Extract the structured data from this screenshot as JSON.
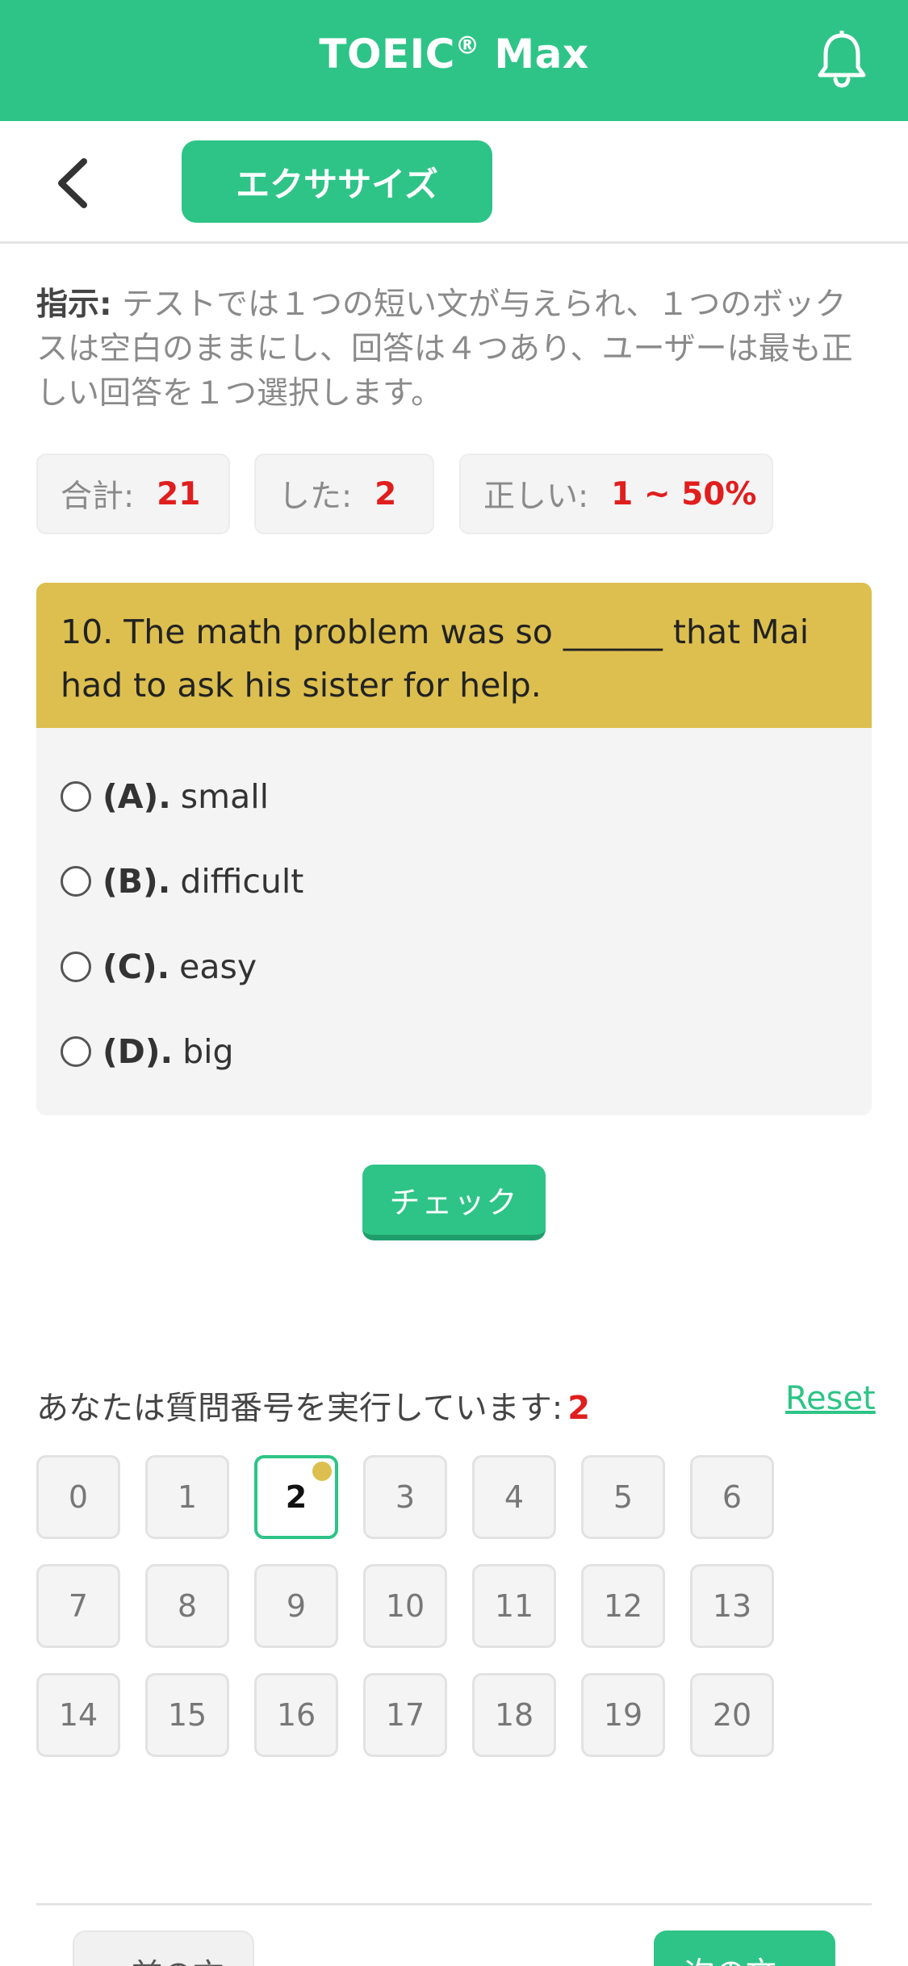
{
  "header": {
    "title": "TOEIC",
    "title_mark": "®",
    "title_suffix": " Max",
    "bell_icon": "bell-icon"
  },
  "subbar": {
    "back_icon": "chevron-left-icon",
    "tab_label": "エクササイズ"
  },
  "instructions": {
    "label": "指示:",
    "text": " テストでは１つの短い文が与えられ、１つのボックスは空白のままにし、回答は４つあり、ユーザーは最も正しい回答を１つ選択します。"
  },
  "stats": {
    "total_label": "合計:",
    "total_value": "21",
    "done_label": "した:",
    "done_value": "2",
    "correct_label": "正しい:",
    "correct_value": "1 ~ 50%"
  },
  "question": {
    "text": "10. The math problem was so ______ that Mai had to ask his sister for help.",
    "options": [
      {
        "letter": "(A).",
        "text": "small"
      },
      {
        "letter": "(B).",
        "text": "difficult"
      },
      {
        "letter": "(C).",
        "text": "easy"
      },
      {
        "letter": "(D).",
        "text": "big"
      }
    ]
  },
  "check_label": "チェック",
  "progress": {
    "label": "あなたは質問番号を実行しています:",
    "current": "2",
    "reset_label": "Reset",
    "numbers": [
      "0",
      "1",
      "2",
      "3",
      "4",
      "5",
      "6",
      "7",
      "8",
      "9",
      "10",
      "11",
      "12",
      "13",
      "14",
      "15",
      "16",
      "17",
      "18",
      "19",
      "20"
    ]
  },
  "nav": {
    "prev_label": "« 前の文",
    "next_label": "次の文 »"
  },
  "colors": {
    "accent": "#2ec487",
    "question_bg": "#dcbf4f",
    "highlight": "#e01e1e"
  }
}
